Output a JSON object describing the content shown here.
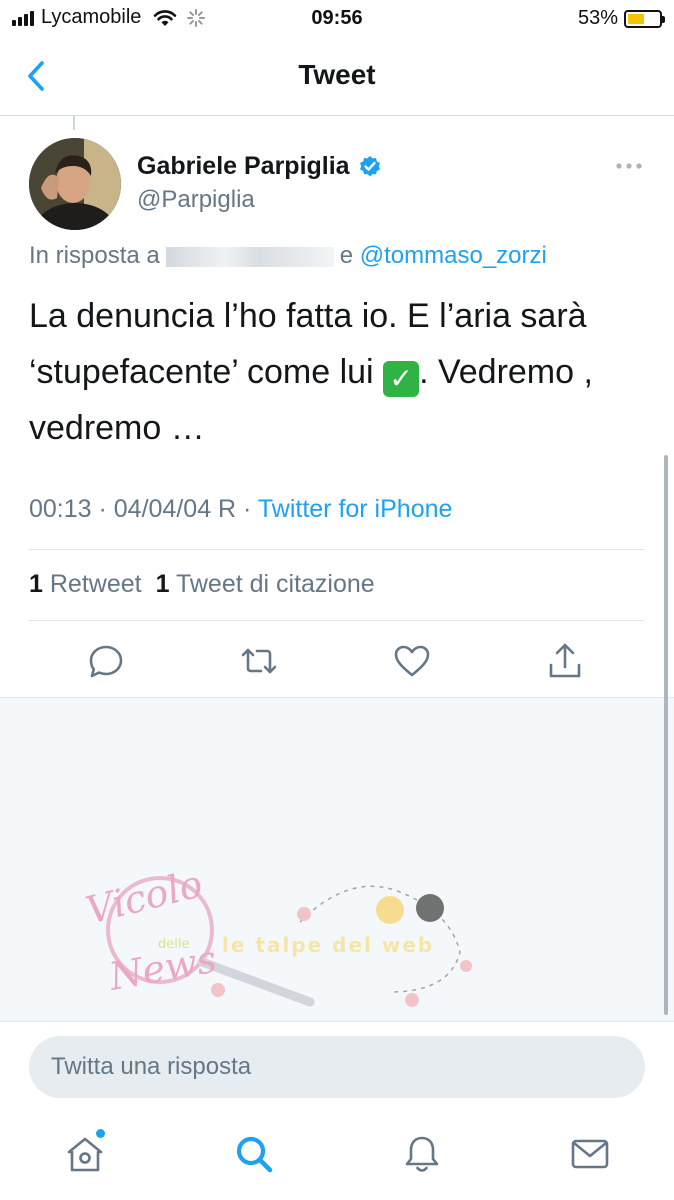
{
  "status_bar": {
    "carrier": "Lycamobile",
    "time": "09:56",
    "battery_percent_label": "53%",
    "battery_level": 0.53,
    "icons": [
      "signal-bars-icon",
      "wifi-icon",
      "loading-spinner-icon",
      "battery-icon"
    ]
  },
  "nav": {
    "title": "Tweet",
    "back_icon": "chevron-left-icon"
  },
  "tweet": {
    "author_name": "Gabriele Parpiglia",
    "handle": "@Parpiglia",
    "verified": true,
    "reply_prefix": "In risposta a",
    "reply_conjunction": "e",
    "reply_mention": "@tommaso_zorzi",
    "text_part1": "La denuncia l’ho fatta io. E l’aria sarà ‘stupefacente’ come lui",
    "emoji": "✅",
    "text_part2": ". Vedremo , vedremo …",
    "timestamp": "00:13 · 04/04/04 R ·",
    "source": "Twitter for iPhone",
    "retweet_count": "1",
    "retweet_label": "Retweet",
    "quote_count": "1",
    "quote_label": "Tweet di citazione",
    "actions": [
      "reply-icon",
      "retweet-icon",
      "like-icon",
      "share-icon"
    ]
  },
  "watermark": {
    "brand_lines": [
      "Vicolo",
      "delle",
      "News"
    ],
    "secondary": "le talpe del web"
  },
  "composer": {
    "placeholder": "Twitta una risposta"
  },
  "tab_bar": {
    "items": [
      "home-icon",
      "search-icon",
      "notifications-icon",
      "messages-icon"
    ],
    "active": "search-icon"
  },
  "colors": {
    "accent": "#1da1f2",
    "text": "#14171a",
    "secondary_text": "#657786",
    "verified_badge": "#1da1f2",
    "battery_fill": "#f5c400",
    "emoji_check": "#2fb344"
  }
}
